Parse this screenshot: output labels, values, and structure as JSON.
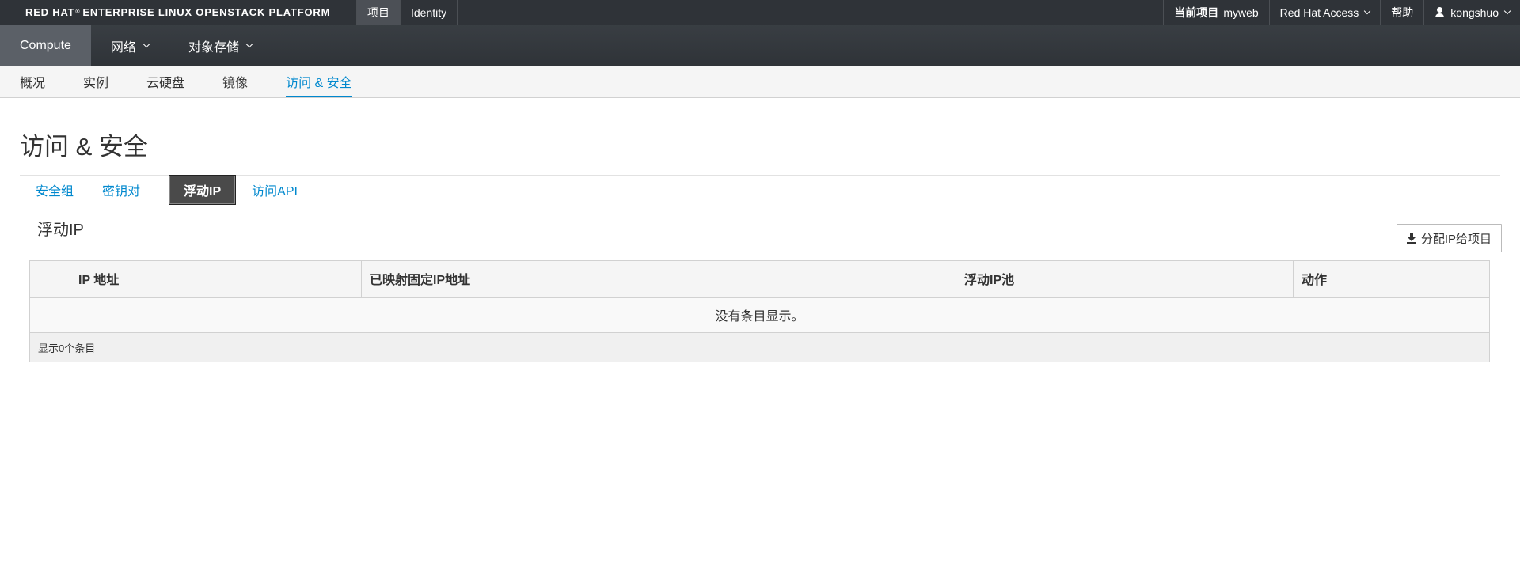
{
  "topbar": {
    "brand": "RED HAT",
    "brand_reg": "®",
    "brand_rest": " ENTERPRISE LINUX OPENSTACK PLATFORM",
    "nav": [
      {
        "label": "项目",
        "active": true
      },
      {
        "label": "Identity",
        "active": false
      }
    ],
    "project_prefix": "当前项目",
    "project_name": "myweb",
    "access_label": "Red Hat Access",
    "help_label": "帮助",
    "user_label": "kongshuo"
  },
  "secnav": {
    "items": [
      {
        "label": "Compute",
        "active": true
      },
      {
        "label": "网络",
        "active": false
      },
      {
        "label": "对象存储",
        "active": false
      }
    ]
  },
  "ternav": {
    "items": [
      {
        "label": "概况"
      },
      {
        "label": "实例"
      },
      {
        "label": "云硬盘"
      },
      {
        "label": "镜像"
      },
      {
        "label": "访问 & 安全",
        "active": true
      }
    ]
  },
  "page": {
    "title": "访问 & 安全",
    "tabs": [
      "安全组",
      "密钥对",
      "浮动IP",
      "访问API"
    ],
    "active_tab": "浮动IP",
    "section_title": "浮动IP",
    "allocate_button": "分配IP给项目",
    "table": {
      "columns": [
        "",
        "IP 地址",
        "已映射固定IP地址",
        "浮动IP池",
        "动作"
      ],
      "empty_message": "没有条目显示。",
      "footer": "显示0个条目"
    }
  }
}
